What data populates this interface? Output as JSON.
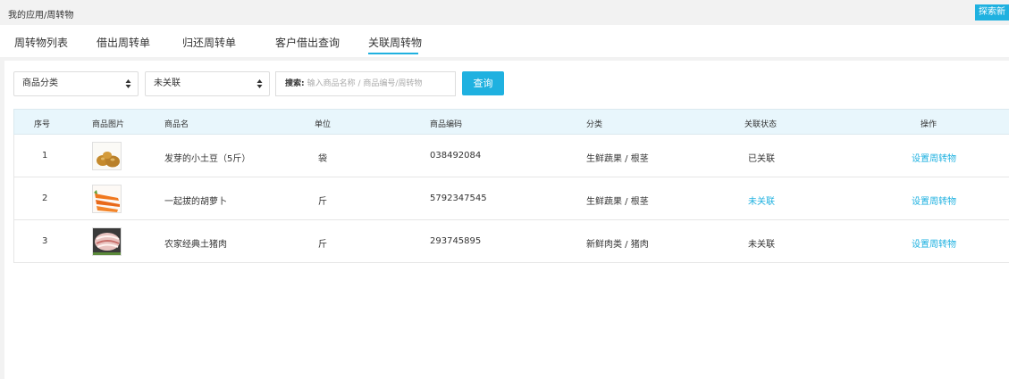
{
  "breadcrumb": "我的应用/周转物",
  "corner_button": "探索新",
  "tabs": [
    {
      "label": "周转物列表"
    },
    {
      "label": "借出周转单"
    },
    {
      "label": "归还周转单"
    },
    {
      "label": "客户借出查询"
    },
    {
      "label": "关联周转物"
    }
  ],
  "active_tab": "关联周转物",
  "filters": {
    "category": "商品分类",
    "link_status": "未关联",
    "search_label": "搜索:",
    "search_placeholder": "输入商品名称 / 商品编号/周转物",
    "query_button": "查询"
  },
  "table": {
    "headers": [
      "序号",
      "商品图片",
      "商品名",
      "单位",
      "商品编码",
      "分类",
      "关联状态",
      "操作"
    ],
    "rows": [
      {
        "index": "1",
        "image": "potato-image",
        "name": "发芽的小土豆（5斤）",
        "unit": "袋",
        "code": "038492084",
        "category": "生鲜蔬果 / 根茎",
        "status": "已关联",
        "action": "设置周转物"
      },
      {
        "index": "2",
        "image": "carrot-image",
        "name": "一起拔的胡萝卜",
        "unit": "斤",
        "code": "5792347545",
        "category": "生鲜蔬果 / 根茎",
        "status": "未关联",
        "action": "设置周转物"
      },
      {
        "index": "3",
        "image": "pork-image",
        "name": "农家经典土猪肉",
        "unit": "斤",
        "code": "293745895",
        "category": "新鲜肉类 / 猪肉",
        "status": "未关联",
        "action": "设置周转物"
      }
    ]
  },
  "colors": {
    "accent": "#1fb1e0",
    "header_bg": "#e8f6fc"
  }
}
